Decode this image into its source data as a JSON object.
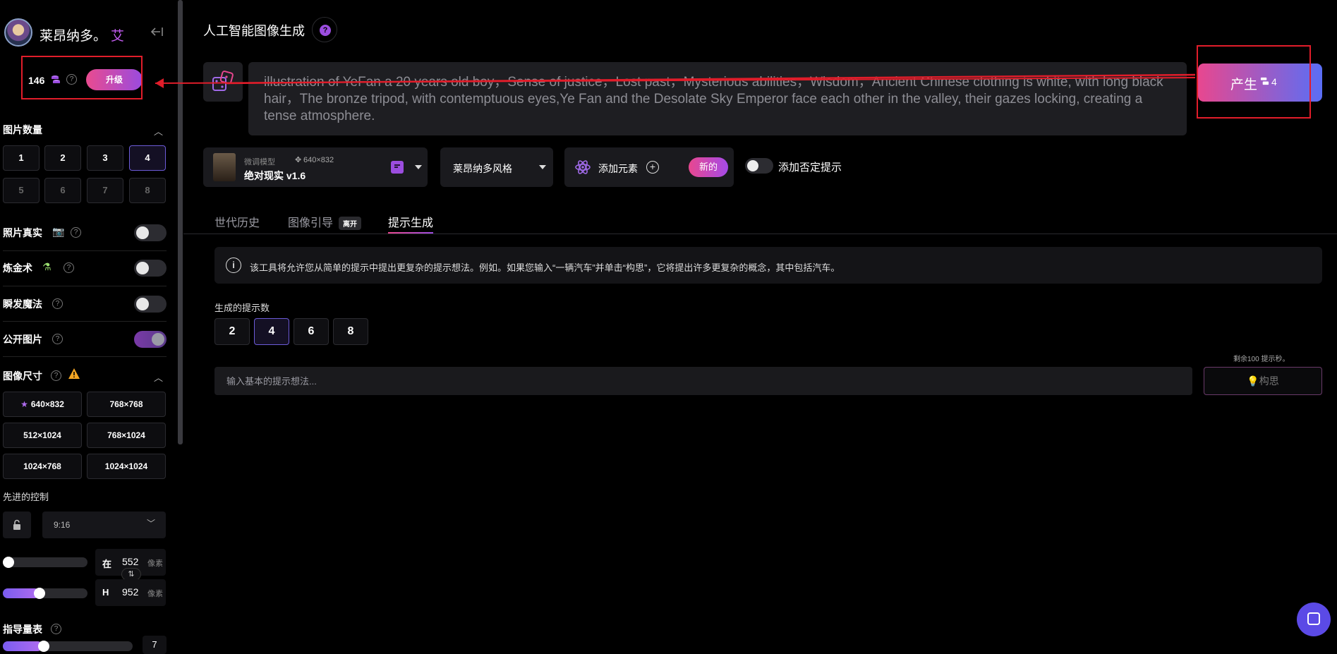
{
  "brand": {
    "name": "莱昂纳多。",
    "ai": "艾"
  },
  "credits": {
    "count": "146",
    "upgrade_label": "升级"
  },
  "sidebar": {
    "image_count": {
      "title": "图片数量",
      "options": [
        "1",
        "2",
        "3",
        "4",
        "5",
        "6",
        "7",
        "8"
      ],
      "selected": "4"
    },
    "photo_real": {
      "label": "照片真实",
      "on": false
    },
    "alchemy": {
      "label": "炼金术",
      "on": false
    },
    "prompt_magic": {
      "label": "瞬发魔法",
      "on": false
    },
    "public_images": {
      "label": "公开图片",
      "on": true
    },
    "image_size": {
      "title": "图像尺寸",
      "options": [
        "640×832",
        "768×768",
        "512×1024",
        "768×1024",
        "1024×768",
        "1024×1024"
      ]
    },
    "advanced": {
      "title": "先进的控制",
      "aspect_ratio": "9:16",
      "width": {
        "label": "在",
        "value": "552",
        "unit": "像素"
      },
      "height": {
        "label": "H",
        "value": "952",
        "unit": "像素"
      }
    },
    "guidance": {
      "title": "指导量表",
      "value": "7"
    }
  },
  "main": {
    "title": "人工智能图像生成",
    "prompt": "illustration of YeFan a 20 years old boy，Sense of justice，Lost past，Mysterious abilities，Wisdom，Ancient Chinese clothing is white, with long black hair，The bronze tripod, with contemptuous eyes,Ye Fan and the Desolate Sky Emperor face each other in the valley, their gazes locking, creating a tense atmosphere.",
    "generate": {
      "label": "产生",
      "cost": "4"
    },
    "model": {
      "tag": "微调模型",
      "size": "640×832",
      "name": "绝对现实 v1.6"
    },
    "style": "莱昂纳多风格",
    "add_element": {
      "label": "添加元素",
      "badge": "新的"
    },
    "negative_prompt_label": "添加否定提示",
    "tabs": [
      {
        "label": "世代历史",
        "badge": ""
      },
      {
        "label": "图像引导",
        "badge": "离开"
      },
      {
        "label": "提示生成",
        "badge": ""
      }
    ],
    "info": "该工具将允许您从简单的提示中提出更复杂的提示想法。例如。如果您输入“一辆汽车”并单击“构思”，它将提出许多更复杂的概念，其中包括汽车。",
    "count_label": "生成的提示数",
    "count_options": [
      "2",
      "4",
      "6",
      "8"
    ],
    "count_selected": "4",
    "remaining": "剩余100 提示秒。",
    "idea_placeholder": "输入基本的提示想法...",
    "idea_button": "构思"
  },
  "colors": {
    "accent_pink": "#e8478f",
    "accent_purple": "#9a4bdf",
    "annotation_red": "#e11d2a"
  }
}
